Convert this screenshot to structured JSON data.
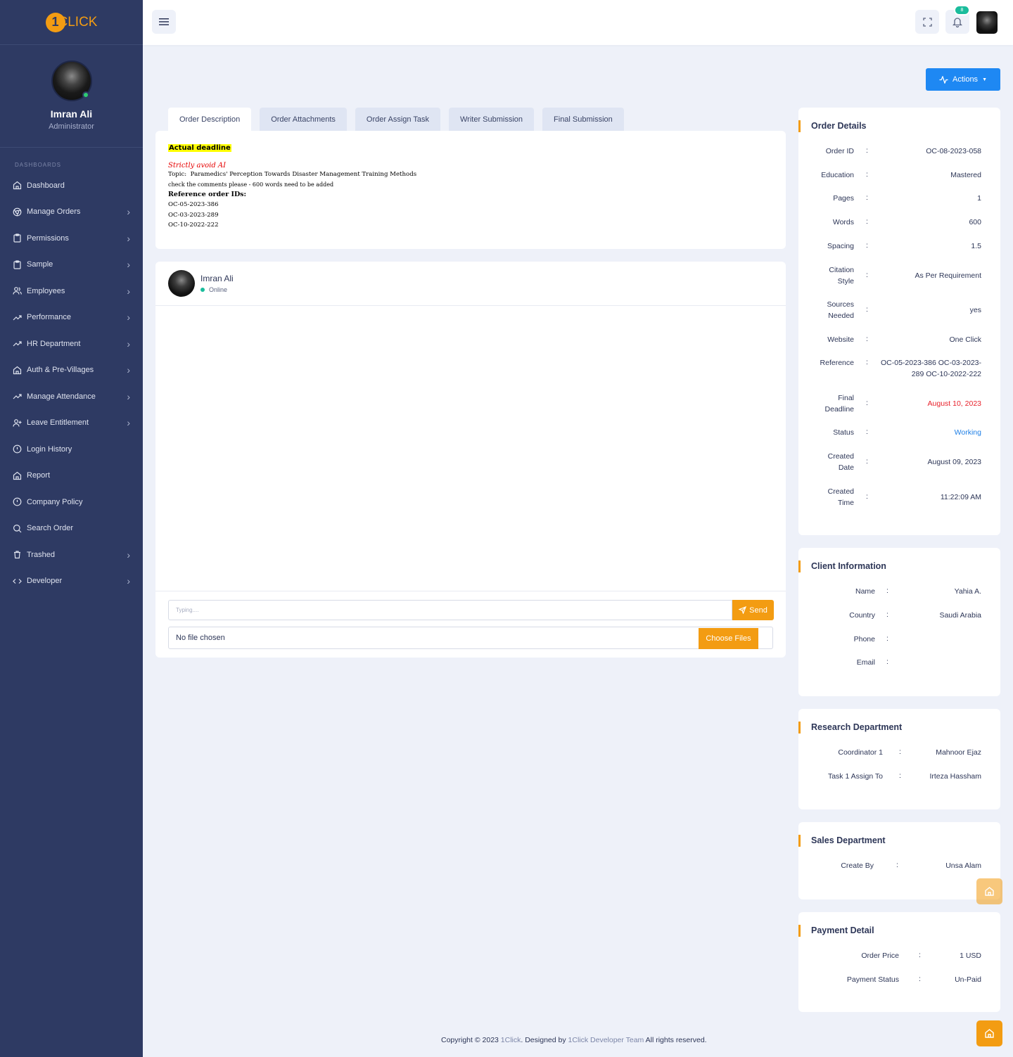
{
  "app": {
    "logo_text": "CLICK",
    "logo_mark": "1"
  },
  "user": {
    "name": "Imran Ali",
    "role": "Administrator"
  },
  "sidebar": {
    "section_title": "DASHBOARDS",
    "items": [
      {
        "label": "Dashboard",
        "icon": "home-icon",
        "has_children": false
      },
      {
        "label": "Manage Orders",
        "icon": "chrome-icon",
        "has_children": true
      },
      {
        "label": "Permissions",
        "icon": "clipboard-icon",
        "has_children": true
      },
      {
        "label": "Sample",
        "icon": "clipboard-icon",
        "has_children": true
      },
      {
        "label": "Employees",
        "icon": "users-icon",
        "has_children": true
      },
      {
        "label": "Performance",
        "icon": "trending-up-icon",
        "has_children": true
      },
      {
        "label": "HR Department",
        "icon": "trending-up-icon",
        "has_children": true
      },
      {
        "label": "Auth & Pre-Villages",
        "icon": "home-icon",
        "has_children": true
      },
      {
        "label": "Manage Attendance",
        "icon": "trending-up-icon",
        "has_children": true
      },
      {
        "label": "Leave Entitlement",
        "icon": "user-plus-icon",
        "has_children": true
      },
      {
        "label": "Login History",
        "icon": "alert-circle-icon",
        "has_children": false
      },
      {
        "label": "Report",
        "icon": "home-icon",
        "has_children": false
      },
      {
        "label": "Company Policy",
        "icon": "alert-circle-icon",
        "has_children": false
      },
      {
        "label": "Search Order",
        "icon": "search-icon",
        "has_children": false
      },
      {
        "label": "Trashed",
        "icon": "trash-icon",
        "has_children": true
      },
      {
        "label": "Developer",
        "icon": "code-icon",
        "has_children": true
      }
    ]
  },
  "topbar": {
    "notification_count": "8"
  },
  "actions_label": "Actions",
  "tabs": [
    {
      "label": "Order Description",
      "active": true
    },
    {
      "label": "Order Attachments",
      "active": false
    },
    {
      "label": "Order Assign Task",
      "active": false
    },
    {
      "label": "Writer Submission",
      "active": false
    },
    {
      "label": "Final Submission",
      "active": false
    }
  ],
  "description": {
    "highlight": "Actual deadline",
    "warning": "Strictly avoid AI",
    "topic_label": "Topic:",
    "topic": "Paramedics' Perception Towards Disaster Management Training Methods",
    "comment": "check the comments please - 600 words need to be added",
    "ref_heading": "Reference order IDs:",
    "refs": [
      "OC-05-2023-386",
      "OC-03-2023-289",
      "OC-10-2022-222"
    ]
  },
  "chat": {
    "name": "Imran Ali",
    "status": "Online",
    "input_placeholder": "Typing....",
    "send_label": "Send",
    "file_text": "No file chosen",
    "file_button": "Choose Files"
  },
  "order_details": {
    "title": "Order Details",
    "rows": [
      {
        "label": "Order ID",
        "value": "OC-08-2023-058"
      },
      {
        "label": "Education",
        "value": "Mastered"
      },
      {
        "label": "Pages",
        "value": "1"
      },
      {
        "label": "Words",
        "value": "600"
      },
      {
        "label": "Spacing",
        "value": "1.5"
      },
      {
        "label": "Citation Style",
        "value": "As Per Requirement"
      },
      {
        "label": "Sources Needed",
        "value": "yes"
      },
      {
        "label": "Website",
        "value": "One Click"
      },
      {
        "label": "Reference",
        "value": "OC-05-2023-386 OC-03-2023-289 OC-10-2022-222"
      },
      {
        "label": "Final Deadline",
        "value": "August 10, 2023"
      },
      {
        "label": "Status",
        "value": "Working"
      },
      {
        "label": "Created Date",
        "value": "August 09, 2023"
      },
      {
        "label": "Created Time",
        "value": "11:22:09 AM"
      }
    ],
    "deadline_color": "#e8202a",
    "status_color": "#1e7fe6"
  },
  "client_info": {
    "title": "Client Information",
    "rows": [
      {
        "label": "Name",
        "value": "Yahia A."
      },
      {
        "label": "Country",
        "value": "Saudi Arabia"
      },
      {
        "label": "Phone",
        "value": ""
      },
      {
        "label": "Email",
        "value": ""
      }
    ]
  },
  "research": {
    "title": "Research Department",
    "rows": [
      {
        "label": "Coordinator 1",
        "value": "Mahnoor Ejaz"
      },
      {
        "label": "Task 1 Assign To",
        "value": "Irteza Hassham"
      }
    ]
  },
  "sales": {
    "title": "Sales Department",
    "rows": [
      {
        "label": "Create By",
        "value": "Unsa Alam"
      }
    ]
  },
  "payment": {
    "title": "Payment Detail",
    "rows": [
      {
        "label": "Order Price",
        "value": "1  USD"
      },
      {
        "label": "Payment Status",
        "value": "Un-Paid"
      }
    ]
  },
  "footer": {
    "prefix": "Copyright © 2023 ",
    "brand": "1Click",
    "middle": ". Designed by ",
    "team": "1Click Developer Team",
    "suffix": " All rights reserved."
  },
  "colors": {
    "accent": "#f39c12",
    "primary": "#1e88f3",
    "sidebar": "#2e3a63"
  }
}
